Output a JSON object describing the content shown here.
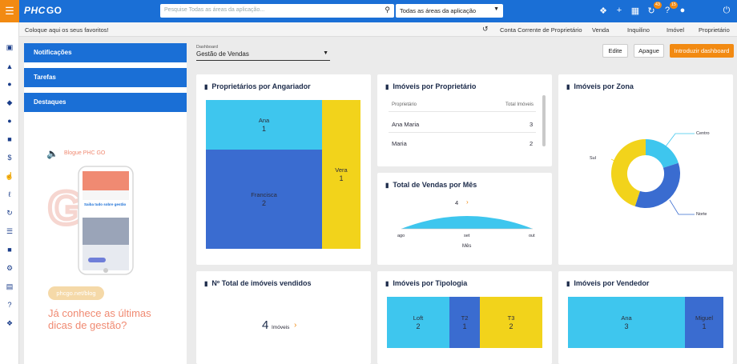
{
  "topbar": {
    "logo_main": "PHC",
    "logo_sub": "GO",
    "search_placeholder": "Pesquise Todas as áreas da aplicação...",
    "scope_value": "Todas as áreas da aplicação",
    "badge_sync": "43",
    "badge_help": "15"
  },
  "favbar": {
    "favorites": "Coloque aqui os seus favoritos!",
    "links": [
      "Conta Corrente de Proprietário",
      "Venda",
      "Inquilino",
      "Imóvel",
      "Proprietário"
    ]
  },
  "left": {
    "buttons": [
      "Notificações",
      "Tarefas",
      "Destaques"
    ],
    "blog_title": "Blogue PHC GO",
    "phone_heading": "Saiba tudo sobre gestão",
    "blog_pill": "phcgo.net/blog",
    "tagline": "Já conhece as últimas dicas de gestão?"
  },
  "dashboard": {
    "label": "Dashboard",
    "value": "Gestão de Vendas",
    "btn_edit": "Edite",
    "btn_delete": "Apague",
    "btn_new": "Introduzir dashboard"
  },
  "colors": {
    "cyan": "#3ec6ee",
    "blue": "#3a6cd0",
    "yellow": "#f2d31b",
    "accent": "#f28a12",
    "brand": "#1a6fd6"
  },
  "cards": {
    "angariador": {
      "title": "Proprietários por Angariador",
      "items": [
        {
          "name": "Ana",
          "value": "1"
        },
        {
          "name": "Francisca",
          "value": "2"
        },
        {
          "name": "Vera",
          "value": "1"
        }
      ]
    },
    "proprietario": {
      "title": "Imóveis por Proprietário",
      "col1": "Proprietário",
      "col2": "Total Imóveis",
      "rows": [
        {
          "name": "Ana Maria",
          "total": "3"
        },
        {
          "name": "Maria",
          "total": "2"
        }
      ]
    },
    "zona": {
      "title": "Imóveis por Zona",
      "labels": [
        "Centro",
        "Sul",
        "Norte"
      ]
    },
    "vendas_mes": {
      "title": "Total de Vendas por Mês",
      "value": "4",
      "months": [
        "ago",
        "set",
        "out"
      ],
      "xlabel": "Mês"
    },
    "vendidos": {
      "title": "Nº Total de imóveis vendidos",
      "value": "4",
      "unit": "Imóveis"
    },
    "tipologia": {
      "title": "Imóveis por Tipologia",
      "items": [
        {
          "name": "Loft",
          "value": "2"
        },
        {
          "name": "T2",
          "value": "1"
        },
        {
          "name": "T3",
          "value": "2"
        }
      ]
    },
    "vendedor": {
      "title": "Imóveis por Vendedor",
      "items": [
        {
          "name": "Ana",
          "value": "3"
        },
        {
          "name": "Miguel",
          "value": "1"
        }
      ]
    }
  },
  "chart_data": [
    {
      "type": "treemap",
      "title": "Proprietários por Angariador",
      "categories": [
        "Ana",
        "Francisca",
        "Vera"
      ],
      "values": [
        1,
        2,
        1
      ]
    },
    {
      "type": "pie",
      "title": "Imóveis por Zona",
      "categories": [
        "Centro",
        "Norte",
        "Sul"
      ],
      "values": [
        1,
        2,
        2
      ]
    },
    {
      "type": "area",
      "title": "Total de Vendas por Mês",
      "x": [
        "ago",
        "set",
        "out"
      ],
      "values": [
        4
      ],
      "xlabel": "Mês"
    },
    {
      "type": "treemap",
      "title": "Imóveis por Tipologia",
      "categories": [
        "Loft",
        "T2",
        "T3"
      ],
      "values": [
        2,
        1,
        2
      ]
    },
    {
      "type": "treemap",
      "title": "Imóveis por Vendedor",
      "categories": [
        "Ana",
        "Miguel"
      ],
      "values": [
        3,
        1
      ]
    }
  ]
}
